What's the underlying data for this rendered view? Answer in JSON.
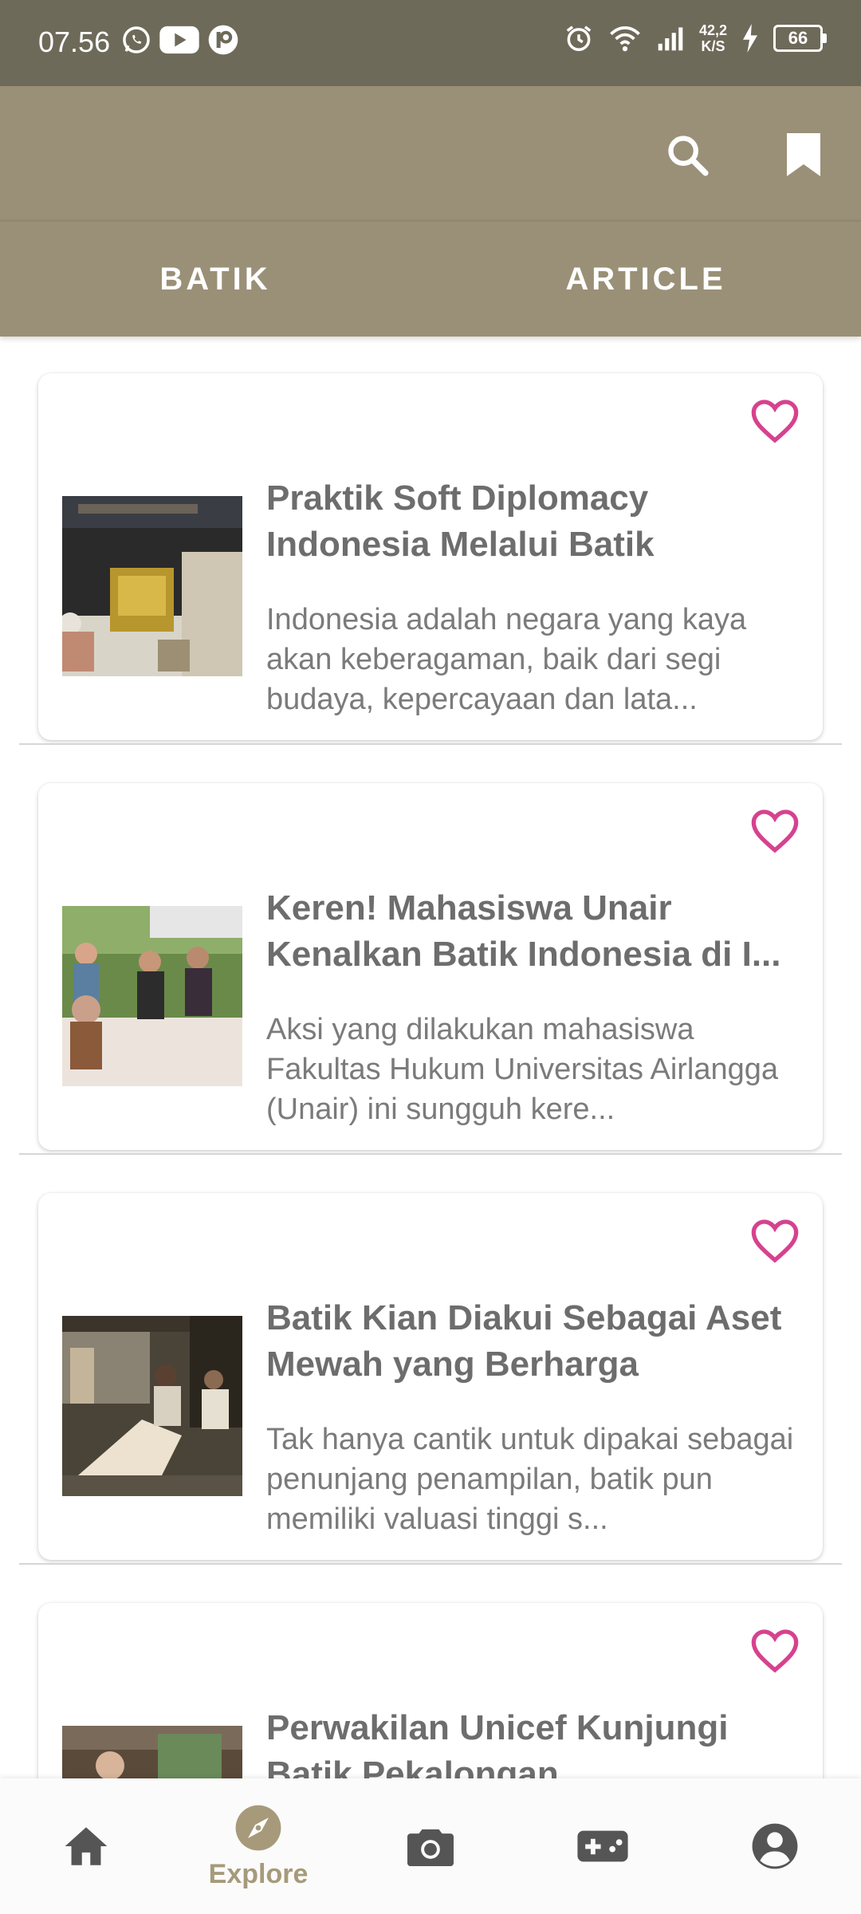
{
  "status_bar": {
    "time": "07.56",
    "speed_value": "42,2",
    "speed_unit": "K/S",
    "battery": "66"
  },
  "tabs": [
    {
      "label": "BATIK"
    },
    {
      "label": "ARTICLE"
    }
  ],
  "articles": [
    {
      "title": "Praktik Soft Diplomacy Indonesia Melalui Batik",
      "description": "Indonesia adalah negara yang kaya akan keberagaman, baik dari segi budaya, kepercayaan dan lata..."
    },
    {
      "title": "Keren! Mahasiswa Unair Kenalkan Batik Indonesia di I...",
      "description": "Aksi yang dilakukan mahasiswa Fakultas Hukum Universitas Airlangga (Unair) ini sungguh kere..."
    },
    {
      "title": "Batik Kian Diakui Sebagai Aset Mewah yang Berharga",
      "description": "Tak hanya cantik untuk dipakai sebagai penunjang penampilan, batik pun memiliki valuasi tinggi s..."
    },
    {
      "title": "Perwakilan Unicef Kunjungi Batik Pekalongan",
      "description": ""
    }
  ],
  "bottom_nav": {
    "active_label": "Explore",
    "items": [
      "home-icon",
      "explore-icon",
      "camera-icon",
      "gamepad-icon",
      "account-icon"
    ]
  },
  "colors": {
    "status_bar": "#6e6a59",
    "app_bar": "#9a9077",
    "heart": "#d6428f",
    "nav_active": "#a69a7a",
    "nav_inactive": "#555555"
  }
}
